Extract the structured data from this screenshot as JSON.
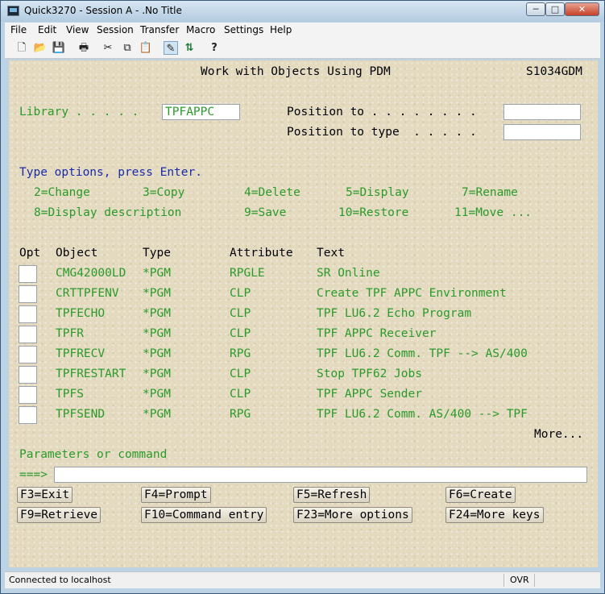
{
  "window": {
    "title": "Quick3270 - Session A - .No Title",
    "controls": {
      "minimize": "─",
      "maximize": "□",
      "close": "✕"
    }
  },
  "menu": [
    "File",
    "Edit",
    "View",
    "Session",
    "Transfer",
    "Macro",
    "Settings",
    "Help"
  ],
  "toolbar": {
    "icons": [
      {
        "name": "new-icon",
        "glyph": "🗋"
      },
      {
        "name": "open-icon",
        "glyph": "📂"
      },
      {
        "name": "save-icon",
        "glyph": "💾"
      },
      {
        "name": "print-icon",
        "glyph": "🖶"
      },
      {
        "name": "cut-icon",
        "glyph": "✂"
      },
      {
        "name": "copy-icon",
        "glyph": "⧉"
      },
      {
        "name": "paste-icon",
        "glyph": "📋"
      },
      {
        "name": "edit-icon",
        "glyph": "✎"
      },
      {
        "name": "transfer-icon",
        "glyph": "⇅"
      },
      {
        "name": "help-icon",
        "glyph": "?"
      }
    ]
  },
  "screen": {
    "title": "Work with Objects Using PDM",
    "system": "S1034GDM",
    "library_label": "Library . . . . .",
    "library_value": "TPFAPPC",
    "position_to_label": "Position to . . . . . . . .",
    "position_to_value": "",
    "position_to_type_label": "Position to type  . . . . .",
    "position_to_type_value": "",
    "instructions": "Type options, press Enter.",
    "options": [
      "2=Change",
      "3=Copy",
      "4=Delete",
      "5=Display",
      "7=Rename",
      "8=Display description",
      "9=Save",
      "10=Restore",
      "11=Move ..."
    ],
    "columns": [
      "Opt",
      "Object",
      "Type",
      "Attribute",
      "Text"
    ],
    "rows": [
      {
        "object": "CMG42000LD",
        "type": "*PGM",
        "attribute": "RPGLE",
        "text": "SR Online"
      },
      {
        "object": "CRTTPFENV",
        "type": "*PGM",
        "attribute": "CLP",
        "text": "Create TPF APPC Environment"
      },
      {
        "object": "TPFECHO",
        "type": "*PGM",
        "attribute": "CLP",
        "text": "TPF LU6.2 Echo Program"
      },
      {
        "object": "TPFR",
        "type": "*PGM",
        "attribute": "CLP",
        "text": "TPF APPC Receiver"
      },
      {
        "object": "TPFRECV",
        "type": "*PGM",
        "attribute": "RPG",
        "text": "TPF LU6.2 Comm. TPF --> AS/400"
      },
      {
        "object": "TPFRESTART",
        "type": "*PGM",
        "attribute": "CLP",
        "text": "Stop TPF62 Jobs"
      },
      {
        "object": "TPFS",
        "type": "*PGM",
        "attribute": "CLP",
        "text": "TPF APPC Sender"
      },
      {
        "object": "TPFSEND",
        "type": "*PGM",
        "attribute": "RPG",
        "text": "TPF LU6.2 Comm. AS/400 --> TPF"
      }
    ],
    "more": "More...",
    "params_label": "Parameters or command",
    "prompt": "===>",
    "command_value": "",
    "fkeys": [
      "F3=Exit",
      "F4=Prompt",
      "F5=Refresh",
      "F6=Create",
      "F9=Retrieve",
      "F10=Command entry",
      "F23=More options",
      "F24=More keys"
    ]
  },
  "status": {
    "connection": "Connected to localhost",
    "mode": "OVR"
  }
}
